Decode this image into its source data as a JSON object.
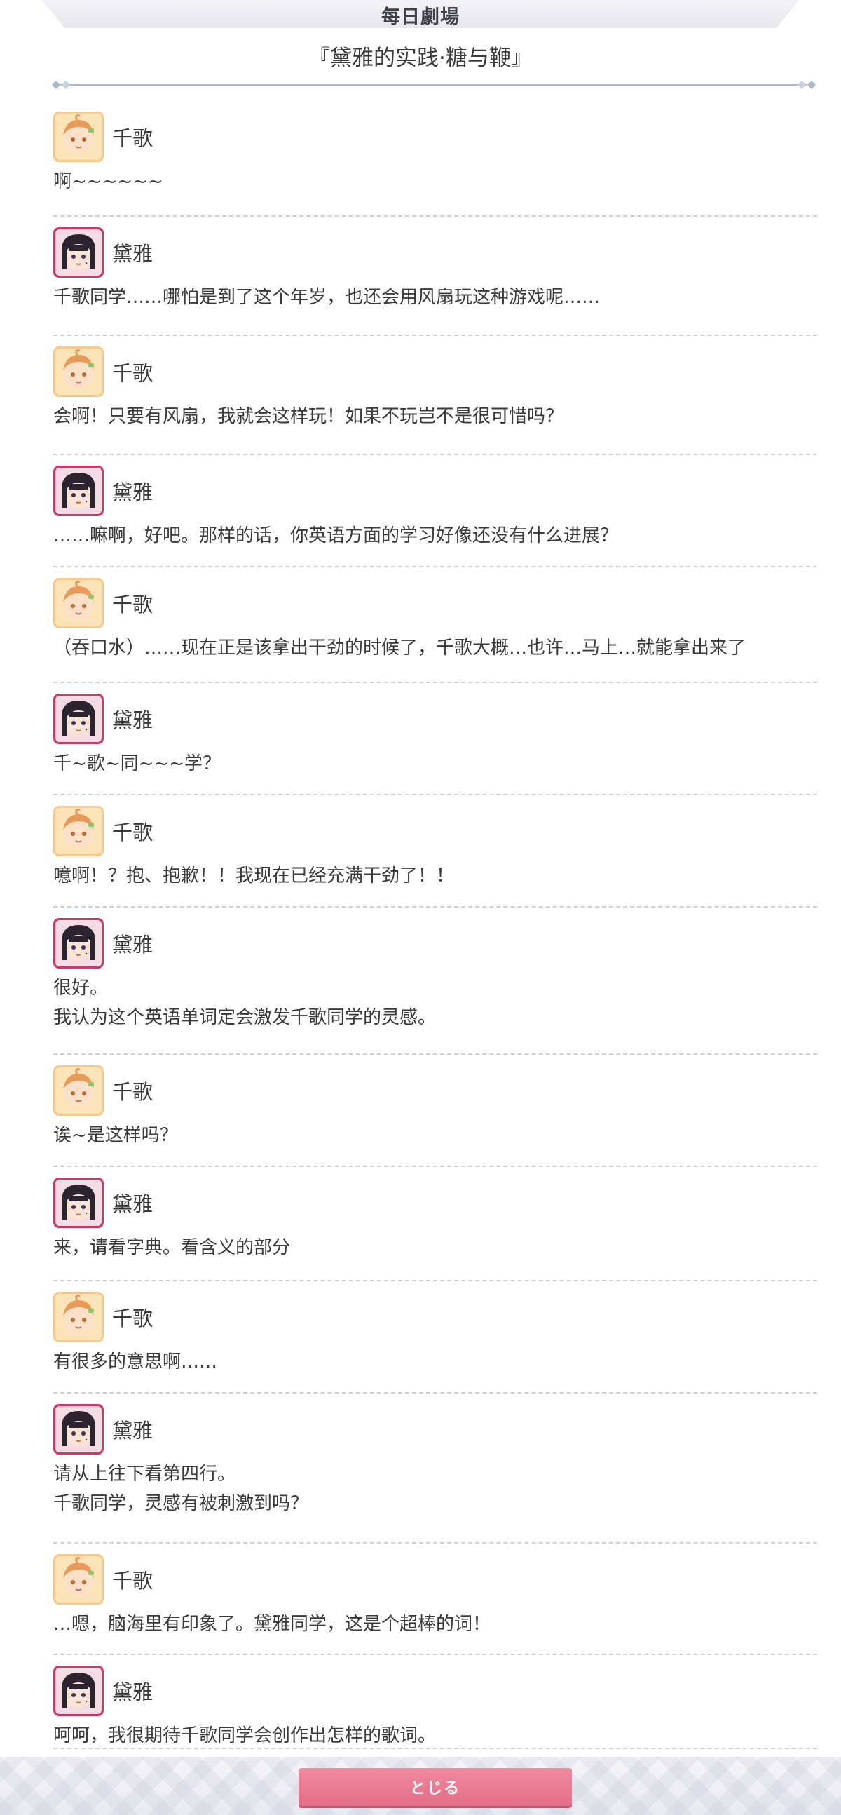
{
  "header": {
    "title": "每日劇場",
    "story_title": "『黛雅的实践·糖与鞭』"
  },
  "colors": {
    "accent_pink": "#e26d87",
    "divider_blue": "#aab8cc",
    "chika_orange": "#e89a58",
    "dia_magenta": "#c93a6a"
  },
  "dialogue": [
    {
      "speaker": "千歌",
      "avatar_icon": "chika-avatar-icon",
      "lines": [
        "啊~~~~~~"
      ]
    },
    {
      "speaker": "黛雅",
      "avatar_icon": "dia-avatar-icon",
      "lines": [
        "千歌同学……哪怕是到了这个年岁，也还会用风扇玩这种游戏呢……"
      ]
    },
    {
      "speaker": "千歌",
      "avatar_icon": "chika-avatar-icon",
      "lines": [
        "会啊！只要有风扇，我就会这样玩！如果不玩岂不是很可惜吗？"
      ]
    },
    {
      "speaker": "黛雅",
      "avatar_icon": "dia-avatar-icon",
      "lines": [
        "……嘛啊，好吧。那样的话，你英语方面的学习好像还没有什么进展？"
      ]
    },
    {
      "speaker": "千歌",
      "avatar_icon": "chika-avatar-icon",
      "lines": [
        "（吞口水）……现在正是该拿出干劲的时候了，千歌大概…也许…马上…就能拿出来了"
      ]
    },
    {
      "speaker": "黛雅",
      "avatar_icon": "dia-avatar-icon",
      "lines": [
        "千~歌~同~~~学？"
      ]
    },
    {
      "speaker": "千歌",
      "avatar_icon": "chika-avatar-icon",
      "lines": [
        "噫啊！？抱、抱歉！！我现在已经充满干劲了！！"
      ]
    },
    {
      "speaker": "黛雅",
      "avatar_icon": "dia-avatar-icon",
      "lines": [
        "很好。",
        "我认为这个英语单词定会激发千歌同学的灵感。"
      ]
    },
    {
      "speaker": "千歌",
      "avatar_icon": "chika-avatar-icon",
      "lines": [
        "诶~是这样吗？"
      ]
    },
    {
      "speaker": "黛雅",
      "avatar_icon": "dia-avatar-icon",
      "lines": [
        "来，请看字典。看含义的部分"
      ]
    },
    {
      "speaker": "千歌",
      "avatar_icon": "chika-avatar-icon",
      "lines": [
        "有很多的意思啊……"
      ]
    },
    {
      "speaker": "黛雅",
      "avatar_icon": "dia-avatar-icon",
      "lines": [
        "请从上往下看第四行。",
        "千歌同学，灵感有被刺激到吗？"
      ]
    },
    {
      "speaker": "千歌",
      "avatar_icon": "chika-avatar-icon",
      "lines": [
        "…嗯，脑海里有印象了。黛雅同学，这是个超棒的词！"
      ]
    },
    {
      "speaker": "黛雅",
      "avatar_icon": "dia-avatar-icon",
      "lines": [
        "呵呵，我很期待千歌同学会创作出怎样的歌词。"
      ]
    }
  ],
  "footer": {
    "close_label": "とじる"
  }
}
